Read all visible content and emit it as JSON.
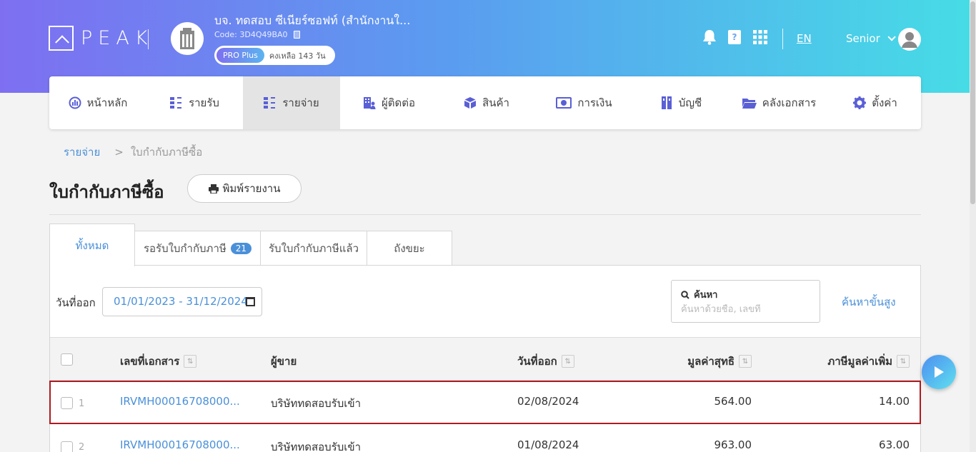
{
  "header": {
    "logo_text": "PEAK",
    "company_name": "บจ. ทดสอบ ซีเนียร์ซอฟท์ (สำนักงานใ...",
    "company_code": "Code: 3D4Q49BA0",
    "plan_badge": "PRO Plus",
    "plan_remaining": "คงเหลือ 143 วัน",
    "language": "EN",
    "user_name": "Senior"
  },
  "nav": {
    "items": [
      {
        "label": "หน้าหลัก",
        "icon": "dashboard-icon"
      },
      {
        "label": "รายรับ",
        "icon": "income-list-icon"
      },
      {
        "label": "รายจ่าย",
        "icon": "expense-list-icon",
        "active": true
      },
      {
        "label": "ผู้ติดต่อ",
        "icon": "contacts-icon"
      },
      {
        "label": "สินค้า",
        "icon": "box-icon"
      },
      {
        "label": "การเงิน",
        "icon": "money-icon"
      },
      {
        "label": "บัญชี",
        "icon": "ledger-icon"
      },
      {
        "label": "คลังเอกสาร",
        "icon": "folder-icon"
      },
      {
        "label": "ตั้งค่า",
        "icon": "gear-icon"
      }
    ]
  },
  "breadcrumb": {
    "parent": "รายจ่าย",
    "separator": ">",
    "current": "ใบกำกับภาษีซื้อ"
  },
  "page": {
    "title": "ใบกำกับภาษีซื้อ",
    "print_label": "พิมพ์รายงาน"
  },
  "tabs": [
    {
      "label": "ทั้งหมด",
      "active": true
    },
    {
      "label": "รอรับใบกำกับภาษี",
      "count": "21"
    },
    {
      "label": "รับใบกำกับภาษีแล้ว"
    },
    {
      "label": "ถังขยะ"
    }
  ],
  "filters": {
    "date_label": "วันที่ออก",
    "date_range": "01/01/2023 - 31/12/2024",
    "search_label": "ค้นหา",
    "search_placeholder": "ค้นหาด้วยชื่อ, เลขที่",
    "advanced_search": "ค้นหาขั้นสูง"
  },
  "table": {
    "columns": [
      "เลขที่เอกสาร",
      "ผู้ขาย",
      "วันที่ออก",
      "มูลค่าสุทธิ",
      "ภาษีมูลค่าเพิ่ม"
    ],
    "rows": [
      {
        "no": "1",
        "doc_no": "IRVMH00016708000...",
        "vendor": "บริษัททดสอบรับเข้า",
        "date": "02/08/2024",
        "net": "564.00",
        "vat": "14.00"
      },
      {
        "no": "2",
        "doc_no": "IRVMH00016708000...",
        "vendor": "บริษัททดสอบรับเข้า",
        "date": "01/08/2024",
        "net": "963.00",
        "vat": "63.00"
      }
    ]
  },
  "colors": {
    "accent": "#4a90d9",
    "selected_row_border": "#b01a1f",
    "nav_icon": "#5a5fd6"
  }
}
